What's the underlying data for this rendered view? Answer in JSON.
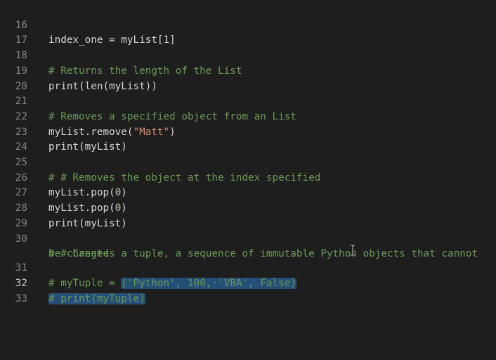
{
  "editor": {
    "lines": [
      {
        "num": "16",
        "text": "index_one = myList[1]"
      },
      {
        "num": "17",
        "text": ""
      },
      {
        "num": "18",
        "text": "# Returns the length of the List"
      },
      {
        "num": "19",
        "text": "print(len(myList))"
      },
      {
        "num": "20",
        "text": ""
      },
      {
        "num": "21",
        "text": "# Removes a specified object from an List"
      },
      {
        "num": "22",
        "text": "myList.remove(\"Matt\")",
        "part_a": "myList.remove(",
        "part_b": "\"Matt\"",
        "part_c": ")"
      },
      {
        "num": "23",
        "text": "print(myList)"
      },
      {
        "num": "24",
        "text": ""
      },
      {
        "num": "25",
        "text": "# # Removes the object at the index specified"
      },
      {
        "num": "26",
        "text": "myList.pop(0)",
        "part_a": "myList.pop(",
        "part_b": "0",
        "part_c": ")"
      },
      {
        "num": "27",
        "text": "myList.pop(0)",
        "part_a": "myList.pop(",
        "part_b": "0",
        "part_c": ")"
      },
      {
        "num": "28",
        "text": "print(myList)"
      },
      {
        "num": "29",
        "text": ""
      },
      {
        "num": "30",
        "text": "# # Creates a tuple, a sequence of immutable Python objects that cannot",
        "wrap": "be changed"
      },
      {
        "num": "31",
        "text": "# myTuple = ('Python', 100, 'VBA', False)",
        "part_a": "# myTuple = ",
        "part_b": "('Python', 100,·'VBA', False)"
      },
      {
        "num": "32",
        "text": "# print(myTuple)",
        "active": true
      },
      {
        "num": "33",
        "text": ""
      }
    ]
  },
  "colors": {
    "background": "#1e1e1e",
    "comment": "#6a9955",
    "string": "#ce9178",
    "number": "#b5cea8",
    "selection": "#264f78"
  },
  "cursor_icon": "i-beam-icon"
}
